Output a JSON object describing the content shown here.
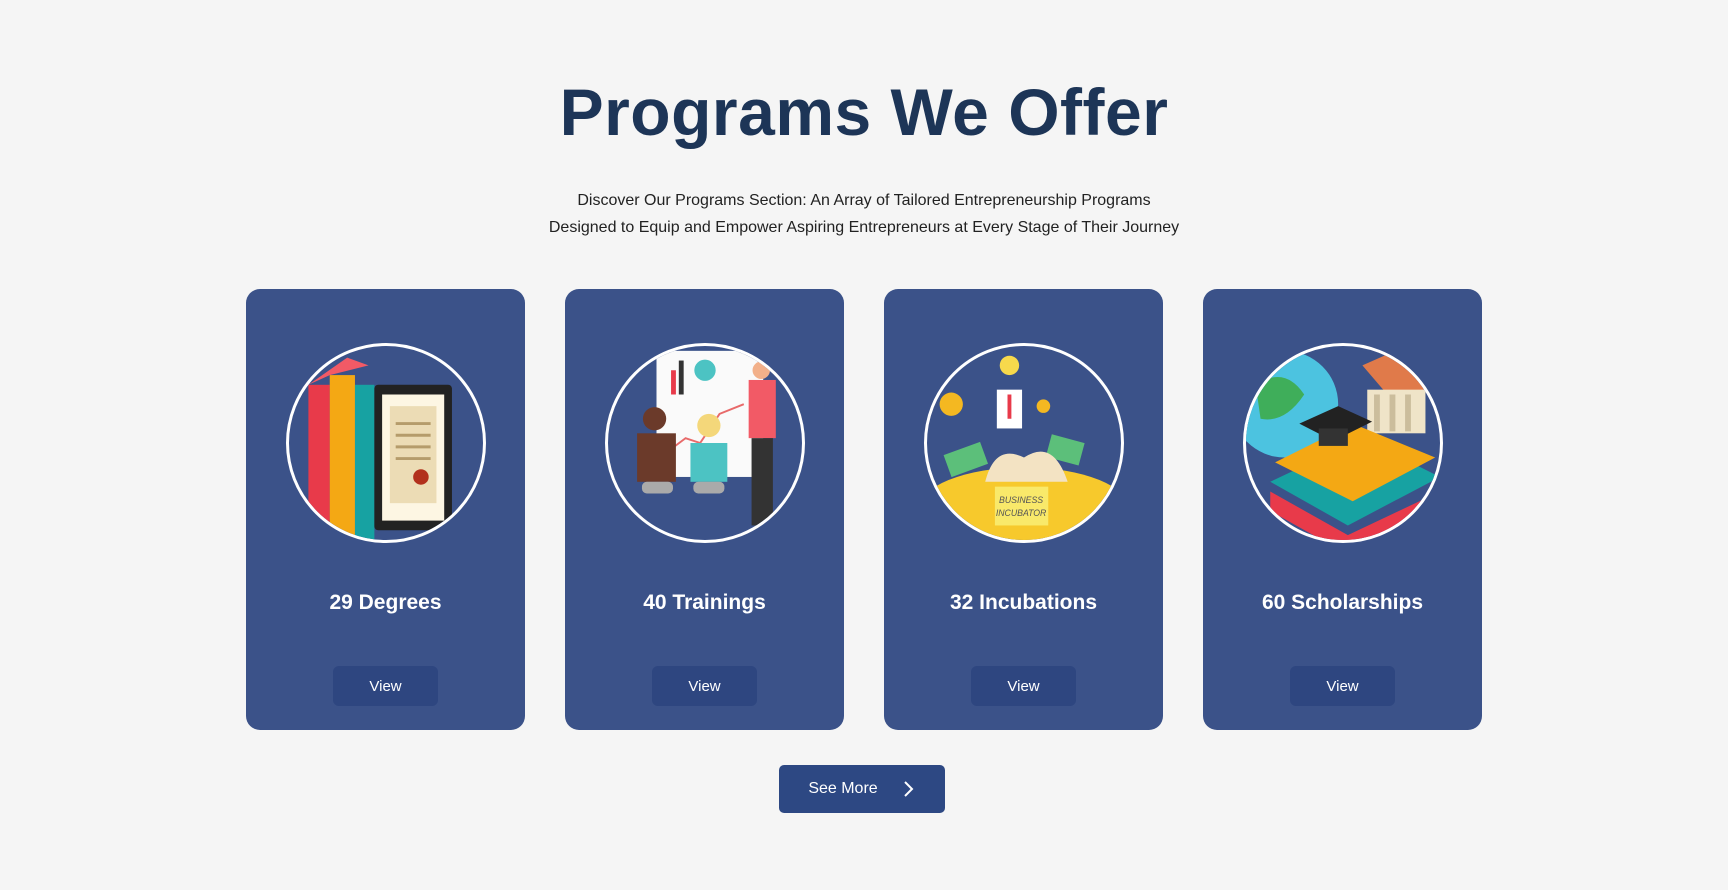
{
  "header": {
    "title": "Programs We Offer",
    "subtitle_line1": "Discover Our Programs Section: An Array of Tailored Entrepreneurship Programs",
    "subtitle_line2": "Designed to Equip and Empower Aspiring Entrepreneurs at Every Stage of Their Journey"
  },
  "cards": [
    {
      "title": "29 Degrees",
      "button": "View",
      "icon": "books-diploma-illustration"
    },
    {
      "title": "40 Trainings",
      "button": "View",
      "icon": "training-presentation-illustration"
    },
    {
      "title": "32 Incubations",
      "button": "View",
      "icon": "business-incubator-illustration",
      "badge": "BUSINESS INCUBATOR"
    },
    {
      "title": "60 Scholarships",
      "button": "View",
      "icon": "graduation-scholarship-illustration"
    }
  ],
  "see_more": {
    "label": "See More",
    "icon": "chevron-right-icon"
  },
  "colors": {
    "background": "#f5f5f5",
    "title": "#1d3557",
    "card": "#3b5289",
    "button": "#2e4680"
  }
}
